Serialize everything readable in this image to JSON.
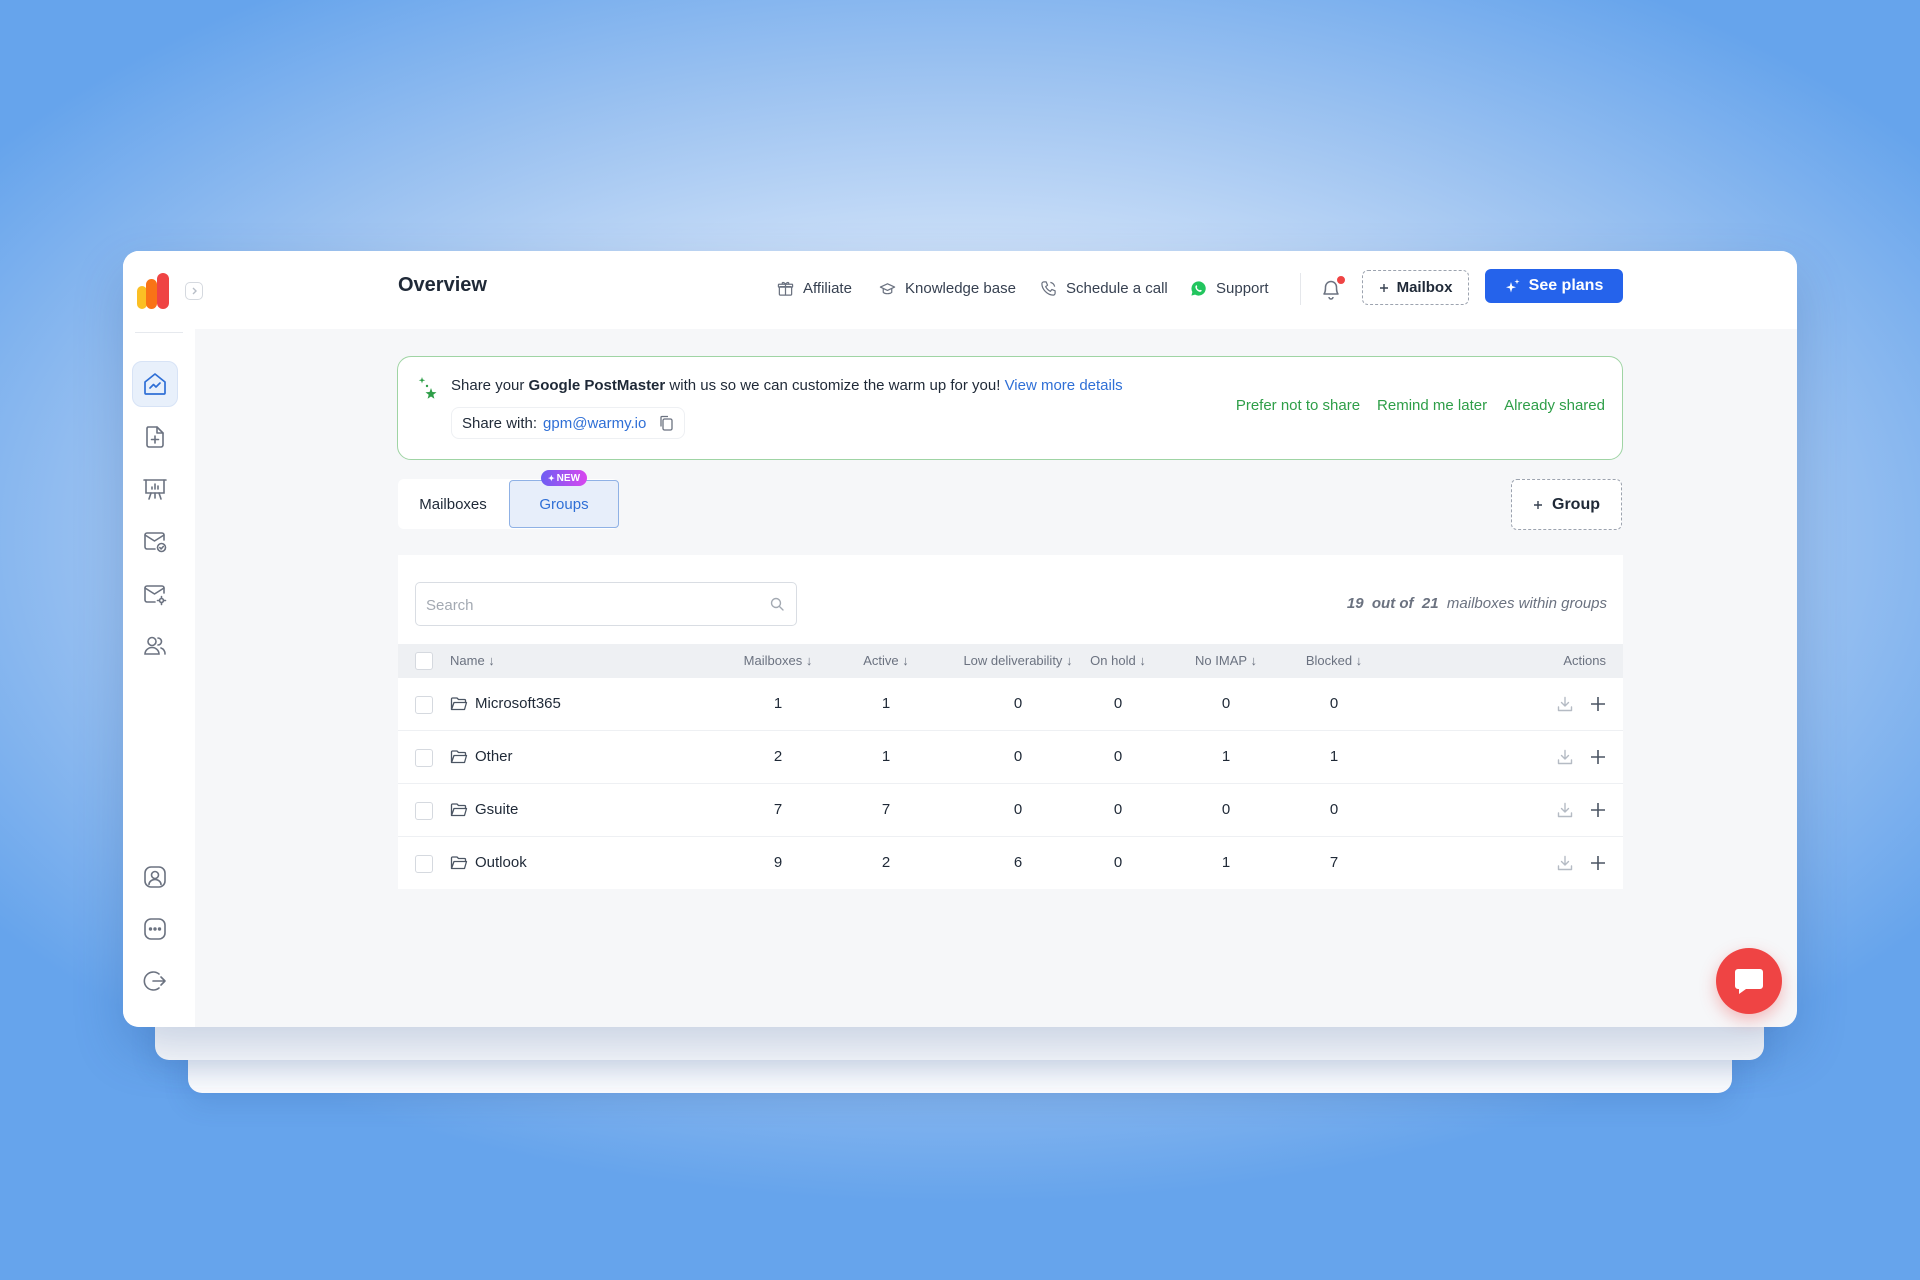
{
  "header": {
    "title": "Overview",
    "links": [
      {
        "label": "Affiliate",
        "icon": "gift-icon"
      },
      {
        "label": "Knowledge base",
        "icon": "graduation-cap-icon"
      },
      {
        "label": "Schedule a call",
        "icon": "phone-icon"
      },
      {
        "label": "Support",
        "icon": "whatsapp-icon"
      }
    ],
    "notification_icon": "bell-icon",
    "mailbox_button": "Mailbox",
    "plans_button": "See plans"
  },
  "sidebar": {
    "top_items": [
      "overview",
      "new-campaign",
      "reports",
      "mailbox-check",
      "mailbox-settings",
      "team"
    ],
    "bottom_items": [
      "profile",
      "chat",
      "logout"
    ]
  },
  "banner": {
    "text_before": "Share your ",
    "bold": "Google PostMaster",
    "text_after": " with us so we can customize the warm up for you! ",
    "link": "View more details",
    "share_label": "Share with: ",
    "share_email": "gpm@warmy.io",
    "actions": [
      "Prefer not to share",
      "Remind me later",
      "Already shared"
    ]
  },
  "tabs": {
    "mailboxes": "Mailboxes",
    "groups": "Groups",
    "new_badge": "NEW",
    "add_group": "Group"
  },
  "table": {
    "search_placeholder": "Search",
    "count_current": "19",
    "count_mid": "out of",
    "count_total": "21",
    "count_suffix": "mailboxes within groups",
    "columns": [
      "Name",
      "Mailboxes",
      "Active",
      "Low deliverability",
      "On hold",
      "No IMAP",
      "Blocked",
      "Actions"
    ],
    "rows": [
      {
        "name": "Microsoft365",
        "mailboxes": "1",
        "active": "1",
        "low": "0",
        "hold": "0",
        "noimap": "0",
        "blocked": "0"
      },
      {
        "name": "Other",
        "mailboxes": "2",
        "active": "1",
        "low": "0",
        "hold": "0",
        "noimap": "1",
        "blocked": "1"
      },
      {
        "name": "Gsuite",
        "mailboxes": "7",
        "active": "7",
        "low": "0",
        "hold": "0",
        "noimap": "0",
        "blocked": "0"
      },
      {
        "name": "Outlook",
        "mailboxes": "9",
        "active": "2",
        "low": "6",
        "hold": "0",
        "noimap": "1",
        "blocked": "7"
      }
    ]
  },
  "colors": {
    "primary": "#2563eb",
    "success": "#2e9e48",
    "link": "#2f6fd6",
    "chat_button": "#ef4444"
  }
}
